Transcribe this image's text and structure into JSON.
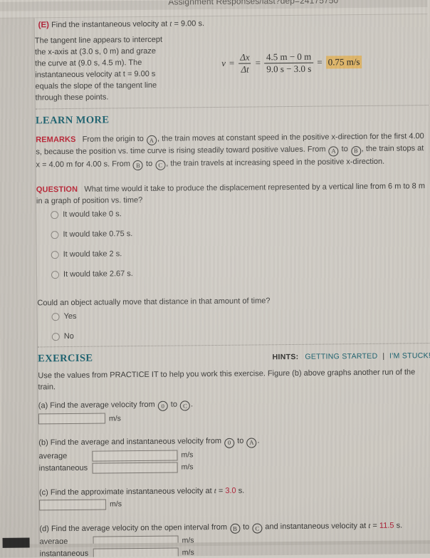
{
  "browser": {
    "url_fragment": "Assignment Responses/last?dep=24175750"
  },
  "part_e": {
    "tag": "(E)",
    "prompt_pre": "Find the instantaneous velocity at ",
    "prompt_var": "t",
    "prompt_post": " = 9.00 s.",
    "body_lines": [
      "The tangent line appears to intercept",
      "the x-axis at (3.0 s, 0 m) and graze",
      "the curve at (9.0 s, 4.5 m). The",
      "instantaneous velocity at t = 9.00 s",
      "equals the slope of the tangent line",
      "through these points."
    ],
    "equation": {
      "lhs": "v",
      "eq1": "=",
      "frac1_num": "Δx",
      "frac1_den": "Δt",
      "eq2": "=",
      "frac2_num": "4.5 m − 0 m",
      "frac2_den": "9.0 s − 3.0 s",
      "eq3": "=",
      "result": "0.75 m/s",
      "result_highlight_color": "#e3b96a"
    }
  },
  "learn_more": {
    "heading": "LEARN MORE",
    "remarks_label": "REMARKS",
    "remarks_text_1": "From the origin to ",
    "remarks_circle_1": "A",
    "remarks_text_2": ", the train moves at constant speed in the positive x-direction for the first 4.00 s, because the position vs. time curve is rising steadily toward positive values. From ",
    "remarks_circle_2": "A",
    "remarks_text_3": " to ",
    "remarks_circle_3": "B",
    "remarks_text_4": ", the train stops at x = 4.00 m for 4.00 s. From ",
    "remarks_circle_4": "B",
    "remarks_text_5": " to ",
    "remarks_circle_5": "C",
    "remarks_text_6": ", the train travels at increasing speed in the positive x-direction."
  },
  "question": {
    "label": "QUESTION",
    "text": "What time would it take to produce the displacement represented by a vertical line from 6 m to 8 m in a graph of position vs. time?",
    "options": [
      "It would take 0 s.",
      "It would take 0.75 s.",
      "It would take 2 s.",
      "It would take 2.67 s."
    ],
    "followup_text": "Could an object actually move that distance in that amount of time?",
    "followup_options": [
      "Yes",
      "No"
    ]
  },
  "exercise": {
    "heading": "EXERCISE",
    "hints_label": "HINTS:",
    "hint_getting_started": "GETTING STARTED",
    "hint_separator": "|",
    "hint_im_stuck": "I'M STUCK!",
    "intro": "Use the values from PRACTICE IT to help you work this exercise. Figure (b) above graphs another run of the train.",
    "parts": [
      {
        "id": "(a)",
        "prompt_pre": "Find the average velocity from ",
        "circle_from": "0",
        "mid": " to ",
        "circle_to": "C",
        "prompt_post": ".",
        "fields": [
          {
            "label": "",
            "value": "",
            "unit": "m/s",
            "width": "narrow"
          }
        ]
      },
      {
        "id": "(b)",
        "prompt_pre": "Find the average and instantaneous velocity from ",
        "circle_from": "0",
        "mid": " to ",
        "circle_to": "A",
        "prompt_post": ".",
        "fields": [
          {
            "label": "average",
            "value": "",
            "unit": "m/s",
            "width": "wide"
          },
          {
            "label": "instantaneous",
            "value": "",
            "unit": "m/s",
            "width": "wide"
          }
        ]
      },
      {
        "id": "(c)",
        "prompt_pre": "Find the approximate instantaneous velocity at ",
        "var": "t",
        "eq": " = ",
        "value_red": "3.0",
        "prompt_post": " s.",
        "fields": [
          {
            "label": "",
            "value": "",
            "unit": "m/s",
            "width": "narrow"
          }
        ]
      },
      {
        "id": "(d)",
        "prompt_pre": "Find the average velocity on the open interval from ",
        "circle_from": "B",
        "mid": " to ",
        "circle_to": "C",
        "prompt_mid2": " and instantaneous velocity at ",
        "var": "t",
        "eq": " = ",
        "value_red": "11.5",
        "prompt_post": " s.",
        "fields": [
          {
            "label": "average",
            "value": "",
            "unit": "m/s",
            "width": "wide"
          },
          {
            "label": "instantaneous",
            "value": "",
            "unit": "m/s",
            "width": "wide"
          }
        ]
      }
    ]
  },
  "colors": {
    "accent_red": "#b3243a",
    "accent_teal": "#17606e",
    "highlight": "#e3b96a",
    "page_bg": "#d2cec7"
  }
}
